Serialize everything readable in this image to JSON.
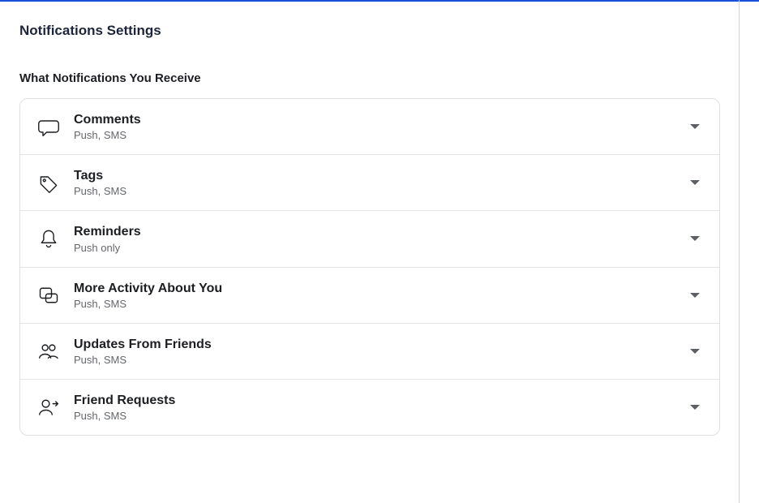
{
  "page": {
    "title": "Notifications Settings"
  },
  "section": {
    "heading": "What Notifications You Receive"
  },
  "items": [
    {
      "title": "Comments",
      "sub": "Push, SMS"
    },
    {
      "title": "Tags",
      "sub": "Push, SMS"
    },
    {
      "title": "Reminders",
      "sub": "Push only"
    },
    {
      "title": "More Activity About You",
      "sub": "Push, SMS"
    },
    {
      "title": "Updates From Friends",
      "sub": "Push, SMS"
    },
    {
      "title": "Friend Requests",
      "sub": "Push, SMS"
    }
  ]
}
